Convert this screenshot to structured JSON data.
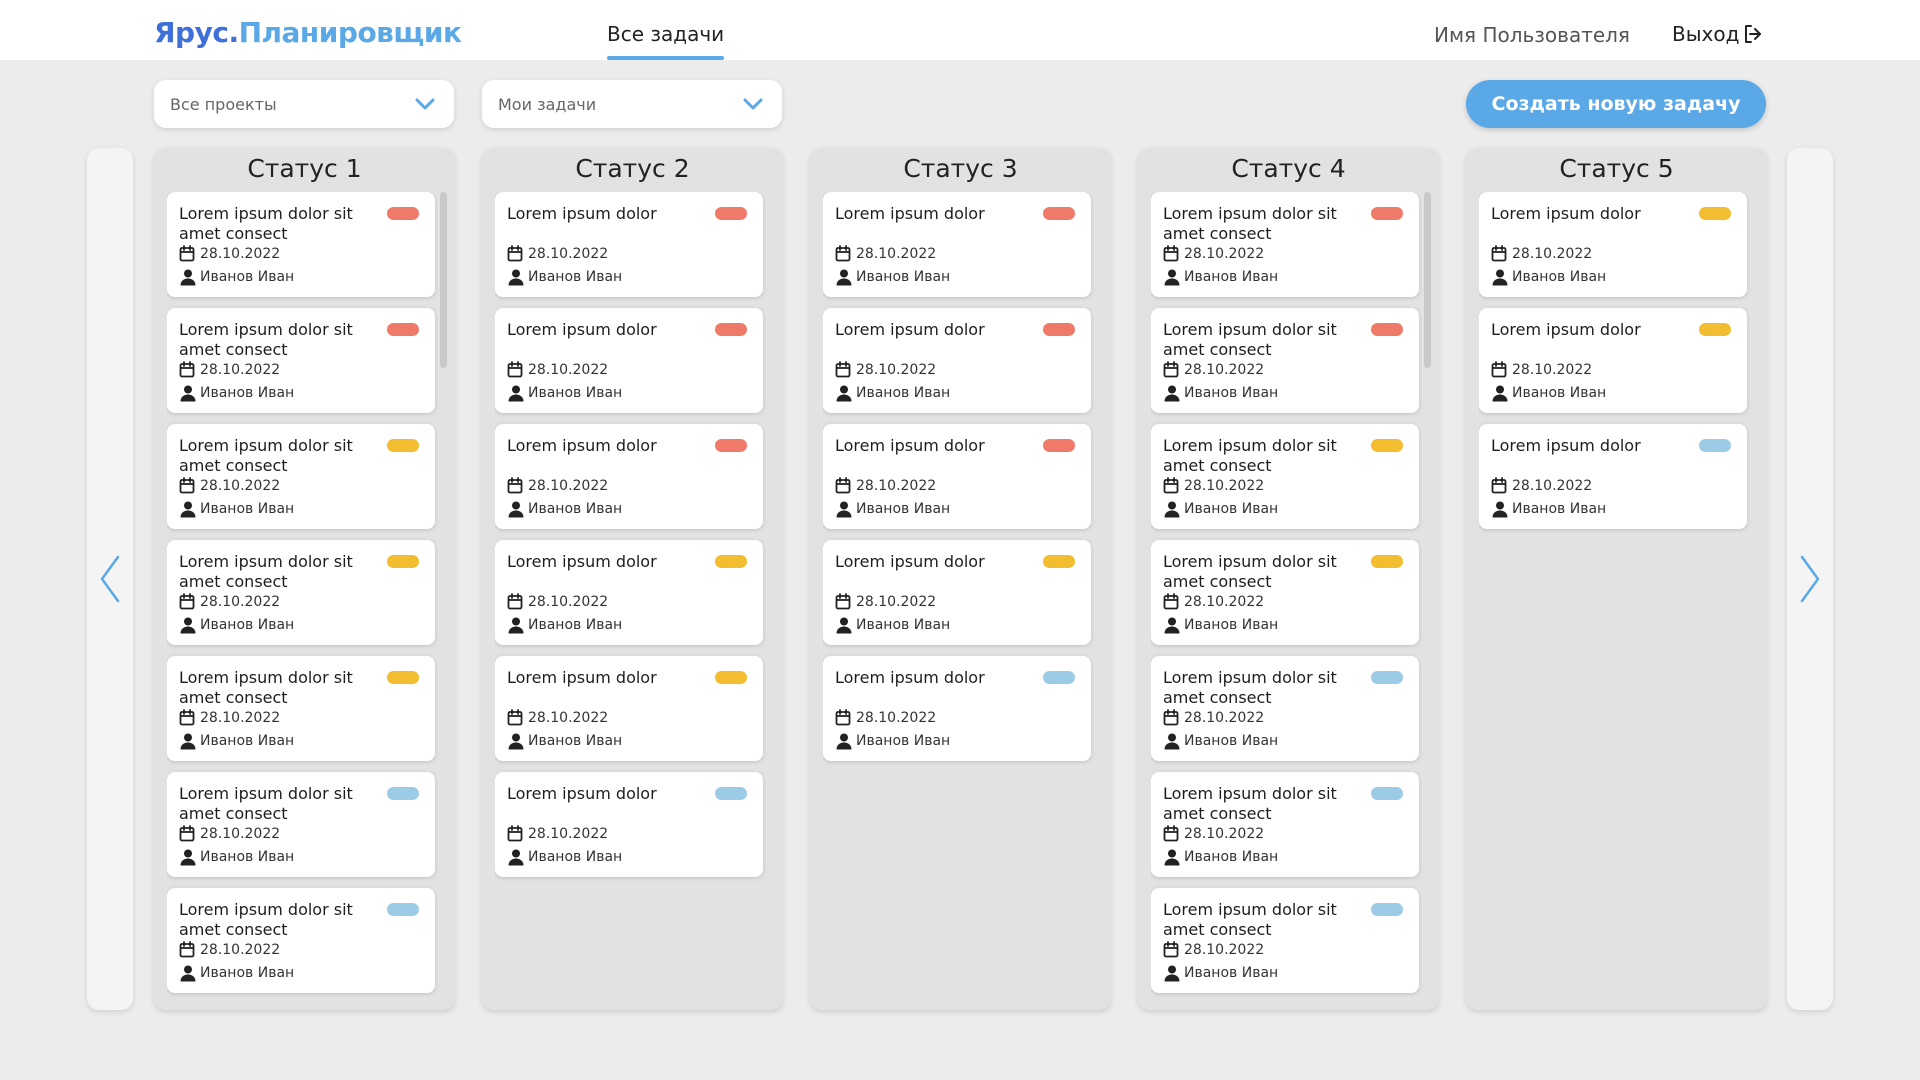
{
  "header": {
    "logo_part1": "Ярус.",
    "logo_part2": "Планировщик",
    "nav_tab": "Все задачи",
    "username": "Имя Пользователя",
    "logout": "Выход"
  },
  "filters": {
    "projects": "Все проекты",
    "tasks": "Мои задачи"
  },
  "create_button": "Создать новую задачу",
  "colors": {
    "accent": "#5aa9e6",
    "high": "#f07a6a",
    "medium": "#f2bd2e",
    "low": "#9ccbe6"
  },
  "columns": [
    {
      "title": "Статус 1",
      "cards": [
        {
          "title": "Lorem ipsum dolor sit amet consect",
          "priority": "high",
          "date": "28.10.2022",
          "user": "Иванов Иван"
        },
        {
          "title": "Lorem ipsum dolor sit amet consect",
          "priority": "high",
          "date": "28.10.2022",
          "user": "Иванов Иван"
        },
        {
          "title": "Lorem ipsum dolor sit amet consect",
          "priority": "medium",
          "date": "28.10.2022",
          "user": "Иванов Иван"
        },
        {
          "title": "Lorem ipsum dolor sit amet consect",
          "priority": "medium",
          "date": "28.10.2022",
          "user": "Иванов Иван"
        },
        {
          "title": "Lorem ipsum dolor sit amet consect",
          "priority": "medium",
          "date": "28.10.2022",
          "user": "Иванов Иван"
        },
        {
          "title": "Lorem ipsum dolor sit amet consect",
          "priority": "low",
          "date": "28.10.2022",
          "user": "Иванов Иван"
        },
        {
          "title": "Lorem ipsum dolor sit amet consect",
          "priority": "low",
          "date": "28.10.2022",
          "user": "Иванов Иван"
        }
      ]
    },
    {
      "title": "Статус 2",
      "cards": [
        {
          "title": "Lorem ipsum dolor",
          "priority": "high",
          "date": "28.10.2022",
          "user": "Иванов Иван"
        },
        {
          "title": "Lorem ipsum dolor",
          "priority": "high",
          "date": "28.10.2022",
          "user": "Иванов Иван"
        },
        {
          "title": "Lorem ipsum dolor",
          "priority": "high",
          "date": "28.10.2022",
          "user": "Иванов Иван"
        },
        {
          "title": "Lorem ipsum dolor",
          "priority": "medium",
          "date": "28.10.2022",
          "user": "Иванов Иван"
        },
        {
          "title": "Lorem ipsum dolor",
          "priority": "medium",
          "date": "28.10.2022",
          "user": "Иванов Иван"
        },
        {
          "title": "Lorem ipsum dolor",
          "priority": "low",
          "date": "28.10.2022",
          "user": "Иванов Иван"
        }
      ]
    },
    {
      "title": "Статус 3",
      "cards": [
        {
          "title": "Lorem ipsum dolor",
          "priority": "high",
          "date": "28.10.2022",
          "user": "Иванов Иван"
        },
        {
          "title": "Lorem ipsum dolor",
          "priority": "high",
          "date": "28.10.2022",
          "user": "Иванов Иван"
        },
        {
          "title": "Lorem ipsum dolor",
          "priority": "high",
          "date": "28.10.2022",
          "user": "Иванов Иван"
        },
        {
          "title": "Lorem ipsum dolor",
          "priority": "medium",
          "date": "28.10.2022",
          "user": "Иванов Иван"
        },
        {
          "title": "Lorem ipsum dolor",
          "priority": "low",
          "date": "28.10.2022",
          "user": "Иванов Иван"
        }
      ]
    },
    {
      "title": "Статус 4",
      "cards": [
        {
          "title": "Lorem ipsum dolor sit amet consect",
          "priority": "high",
          "date": "28.10.2022",
          "user": "Иванов Иван"
        },
        {
          "title": "Lorem ipsum dolor sit amet consect",
          "priority": "high",
          "date": "28.10.2022",
          "user": "Иванов Иван"
        },
        {
          "title": "Lorem ipsum dolor sit amet consect",
          "priority": "medium",
          "date": "28.10.2022",
          "user": "Иванов Иван"
        },
        {
          "title": "Lorem ipsum dolor sit amet consect",
          "priority": "medium",
          "date": "28.10.2022",
          "user": "Иванов Иван"
        },
        {
          "title": "Lorem ipsum dolor sit amet consect",
          "priority": "low",
          "date": "28.10.2022",
          "user": "Иванов Иван"
        },
        {
          "title": "Lorem ipsum dolor sit amet consect",
          "priority": "low",
          "date": "28.10.2022",
          "user": "Иванов Иван"
        },
        {
          "title": "Lorem ipsum dolor sit amet consect",
          "priority": "low",
          "date": "28.10.2022",
          "user": "Иванов Иван"
        }
      ]
    },
    {
      "title": "Статус 5",
      "cards": [
        {
          "title": "Lorem ipsum dolor",
          "priority": "medium",
          "date": "28.10.2022",
          "user": "Иванов Иван"
        },
        {
          "title": "Lorem ipsum dolor",
          "priority": "medium",
          "date": "28.10.2022",
          "user": "Иванов Иван"
        },
        {
          "title": "Lorem ipsum dolor",
          "priority": "low",
          "date": "28.10.2022",
          "user": "Иванов Иван"
        }
      ]
    }
  ]
}
